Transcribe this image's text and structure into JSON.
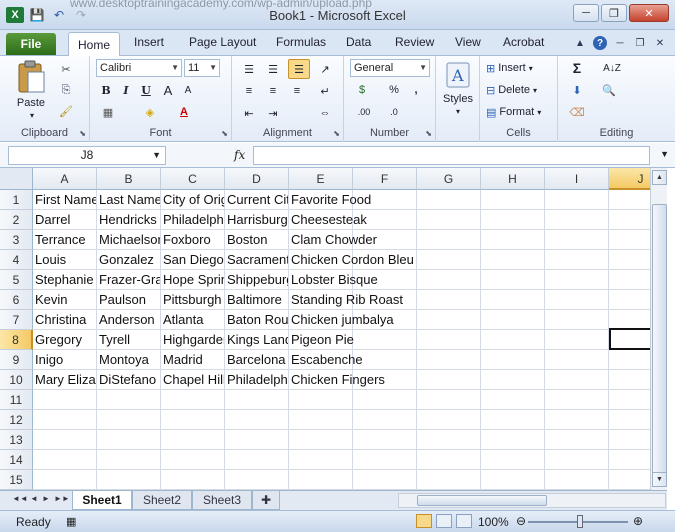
{
  "window": {
    "title": "Book1 - Microsoft Excel",
    "ghost_url": "www.desktoptrainingacademy.com/wp-admin/upload.php",
    "buttons": {
      "minimize": "─",
      "restore": "❐",
      "close": "✕"
    }
  },
  "tabs": [
    "File",
    "Home",
    "Insert",
    "Page Layout",
    "Formulas",
    "Data",
    "Review",
    "View",
    "Acrobat"
  ],
  "ribbon": {
    "clipboard": {
      "label": "Clipboard",
      "paste": "Paste"
    },
    "font": {
      "label": "Font",
      "name": "Calibri",
      "size": "11"
    },
    "alignment": {
      "label": "Alignment"
    },
    "number": {
      "label": "Number",
      "format": "General"
    },
    "styles": {
      "label": "Styles"
    },
    "cells": {
      "label": "Cells",
      "insert": "Insert",
      "delete": "Delete",
      "format": "Format"
    },
    "editing": {
      "label": "Editing"
    }
  },
  "formula_bar": {
    "name_box": "J8",
    "fx": "fx",
    "value": ""
  },
  "columns": [
    "A",
    "B",
    "C",
    "D",
    "E",
    "F",
    "G",
    "H",
    "I",
    "J"
  ],
  "selected_column": "J",
  "selected_row": "8",
  "rows": [
    {
      "n": "1",
      "cells": [
        "First Name",
        "Last Name",
        "City of Origin",
        "Current City",
        "Favorite Food"
      ]
    },
    {
      "n": "2",
      "cells": [
        "Darrel",
        "Hendricks",
        "Philadelphia",
        "Harrisburg",
        "Cheesesteak"
      ]
    },
    {
      "n": "3",
      "cells": [
        "Terrance",
        "Michaelson",
        "Foxboro",
        "Boston",
        "Clam Chowder"
      ]
    },
    {
      "n": "4",
      "cells": [
        "Louis",
        "Gonzalez",
        "San Diego",
        "Sacramento",
        "Chicken Cordon Bleu"
      ]
    },
    {
      "n": "5",
      "cells": [
        "Stephanie",
        "Frazer-Grant",
        "Hope Springs",
        "Shippeburg",
        "Lobster Bisque"
      ]
    },
    {
      "n": "6",
      "cells": [
        "Kevin",
        "Paulson",
        "Pittsburgh",
        "Baltimore",
        "Standing Rib Roast"
      ]
    },
    {
      "n": "7",
      "cells": [
        "Christina",
        "Anderson",
        "Atlanta",
        "Baton Rouge",
        "Chicken jumbalya"
      ]
    },
    {
      "n": "8",
      "cells": [
        "Gregory",
        "Tyrell",
        "Highgarden",
        "Kings Landing",
        "Pigeon Pie"
      ]
    },
    {
      "n": "9",
      "cells": [
        "Inigo",
        "Montoya",
        "Madrid",
        "Barcelona",
        "Escabenche"
      ]
    },
    {
      "n": "10",
      "cells": [
        "Mary Elizabeth",
        "DiStefano",
        "Chapel Hill",
        "Philadelphia",
        "Chicken Fingers"
      ]
    },
    {
      "n": "11",
      "cells": []
    },
    {
      "n": "12",
      "cells": []
    },
    {
      "n": "13",
      "cells": []
    },
    {
      "n": "14",
      "cells": []
    },
    {
      "n": "15",
      "cells": []
    }
  ],
  "sheets": [
    "Sheet1",
    "Sheet2",
    "Sheet3"
  ],
  "active_sheet": "Sheet1",
  "status": {
    "ready": "Ready",
    "zoom": "100%"
  }
}
